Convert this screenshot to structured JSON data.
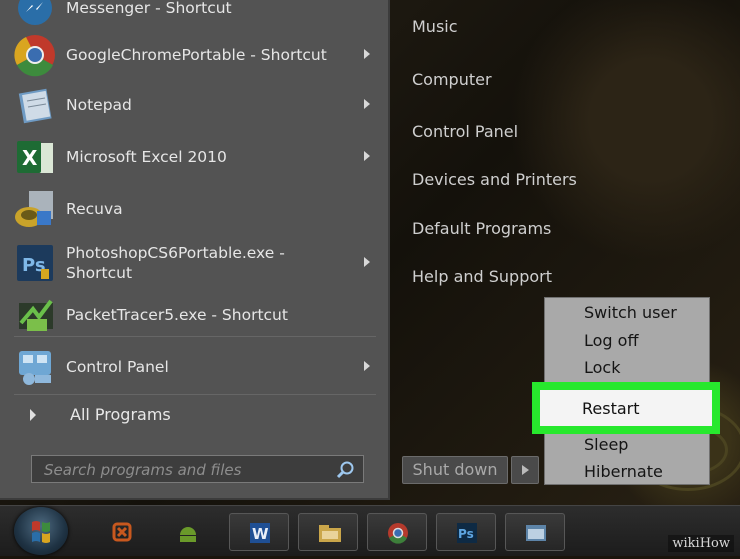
{
  "start_menu": {
    "programs": [
      {
        "label": "Messenger - Shortcut",
        "icon": "messenger-icon",
        "has_submenu": false
      },
      {
        "label": "GoogleChromePortable - Shortcut",
        "icon": "chrome-icon",
        "has_submenu": true
      },
      {
        "label": "Notepad",
        "icon": "notepad-icon",
        "has_submenu": true
      },
      {
        "label": "Microsoft Excel 2010",
        "icon": "excel-icon",
        "has_submenu": true
      },
      {
        "label": "Recuva",
        "icon": "recuva-icon",
        "has_submenu": false
      },
      {
        "label": "PhotoshopCS6Portable.exe - Shortcut",
        "icon": "photoshop-icon",
        "has_submenu": true
      },
      {
        "label": "PacketTracer5.exe - Shortcut",
        "icon": "packettracer-icon",
        "has_submenu": false
      },
      {
        "label": "Control Panel",
        "icon": "control-panel-icon",
        "has_submenu": true
      }
    ],
    "all_programs": "All Programs",
    "search_placeholder": "Search programs and files",
    "right_items": [
      "Music",
      "Computer",
      "Control Panel",
      "Devices and Printers",
      "Default Programs",
      "Help and Support"
    ],
    "shutdown_label": "Shut down"
  },
  "power_menu": {
    "options": [
      "Switch user",
      "Log off",
      "Lock",
      "Restart",
      "Sleep",
      "Hibernate"
    ],
    "highlighted": "Restart",
    "highlight_color": "#27e82d"
  },
  "taskbar": {
    "items": [
      "xampp-icon",
      "android-icon",
      "word-icon",
      "file-explorer-icon",
      "chrome-icon",
      "photoshop-icon",
      "window-icon"
    ]
  },
  "watermark": "wikiHow"
}
